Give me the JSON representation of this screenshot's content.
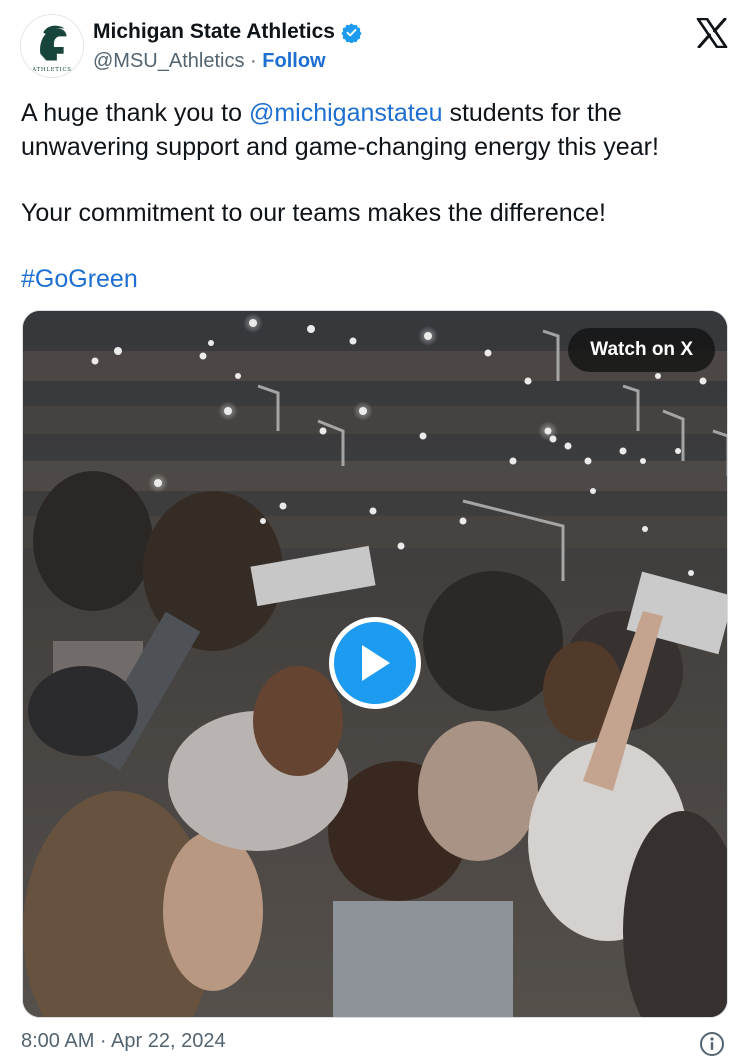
{
  "author": {
    "display_name": "Michigan State Athletics",
    "handle": "@MSU_Athletics",
    "separator": "·",
    "follow_label": "Follow",
    "avatar_icon": "spartan-helmet-logo",
    "avatar_caption": "ATHLETICS",
    "verified_icon": "verified-badge-icon"
  },
  "brand_icon": "x-logo-icon",
  "tweet": {
    "line1_prefix": "A huge thank you to ",
    "mention": "@michiganstateu",
    "line1_suffix": " students for the unwavering support and game-changing energy this year!",
    "paragraph2": "Your commitment to our teams makes the difference!",
    "hashtag": "#GoGreen"
  },
  "media": {
    "watch_label": "Watch on X",
    "play_icon": "play-icon",
    "description_icon": "crowd-video-thumbnail"
  },
  "footer": {
    "timestamp": "8:00 AM · Apr 22, 2024",
    "info_icon": "info-icon"
  },
  "colors": {
    "link": "#1d6fd1",
    "text": "#0f1419",
    "muted": "#536471",
    "play": "#1d9bf0",
    "spartan_green": "#18453b"
  }
}
